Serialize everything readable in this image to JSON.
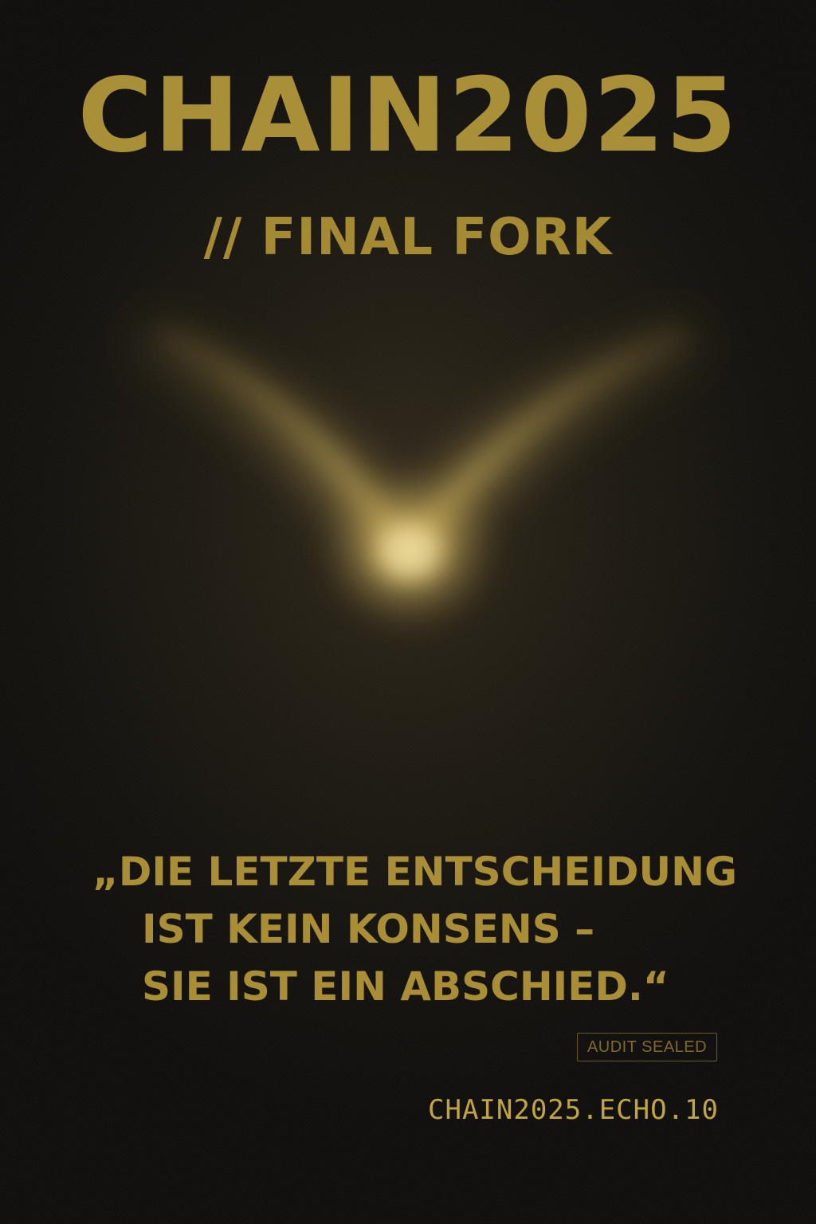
{
  "poster": {
    "title": "CHAIN2025",
    "subtitle": "// FINAL FORK",
    "quote": {
      "line1": "„DIE LETZTE ENTSCHEIDUNG",
      "line2": "IST KEIN KONSENS –",
      "line3": "SIE IST EIN ABSCHIED.“"
    },
    "badge": "AUDIT SEALED",
    "footer": "CHAIN2025.ECHO.10"
  },
  "colors": {
    "background": "#0b0905",
    "gold": "#b7993a",
    "glow": "#f3dc8a"
  }
}
